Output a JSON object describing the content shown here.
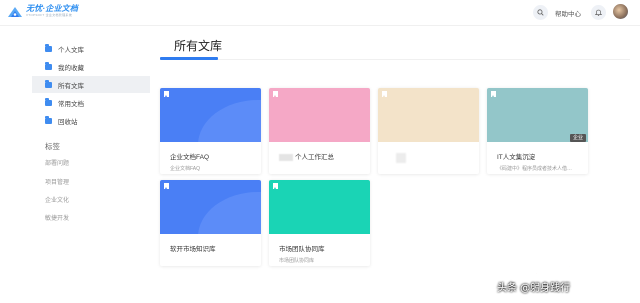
{
  "header": {
    "logo_title": "无忧·企业文档",
    "logo_sub": "VTOPSOFT 企业文档管理系统",
    "help_label": "帮助中心",
    "search_icon": "search-icon",
    "bell_icon": "bell-icon"
  },
  "sidebar": {
    "items": [
      {
        "label": "个人文库",
        "active": false
      },
      {
        "label": "我的收藏",
        "active": false
      },
      {
        "label": "所有文库",
        "active": true
      },
      {
        "label": "常用文档",
        "active": false
      },
      {
        "label": "回收站",
        "active": false
      }
    ],
    "tags_title": "标签",
    "tags": [
      "部署问题",
      "项目管理",
      "企业文化",
      "敏捷开发"
    ]
  },
  "main": {
    "title": "所有文库",
    "cards": [
      {
        "name": "企业文档FAQ",
        "desc": "企业文档FAQ",
        "color": "#4a7ff5"
      },
      {
        "name": "个人工作汇总",
        "desc": "",
        "color": "#f5a8c6"
      },
      {
        "name": "",
        "desc": "",
        "color": "#f3e3c9"
      },
      {
        "name": "IT人文集沉淀",
        "desc": "《码建中》程序员成者技术人借…",
        "color": "#93c6c9",
        "tag": "企业"
      },
      {
        "name": "软开市场知识库",
        "desc": "",
        "color": "#4a7ff5"
      },
      {
        "name": "市场团队协同库",
        "desc": "市场团队协同库",
        "color": "#1ad4b5"
      }
    ]
  },
  "watermark": {
    "big": "锐客网",
    "small": "头条 @躬身践行"
  },
  "colors": {
    "accent": "#2f7cf0",
    "folder": "#3f8cf0"
  }
}
